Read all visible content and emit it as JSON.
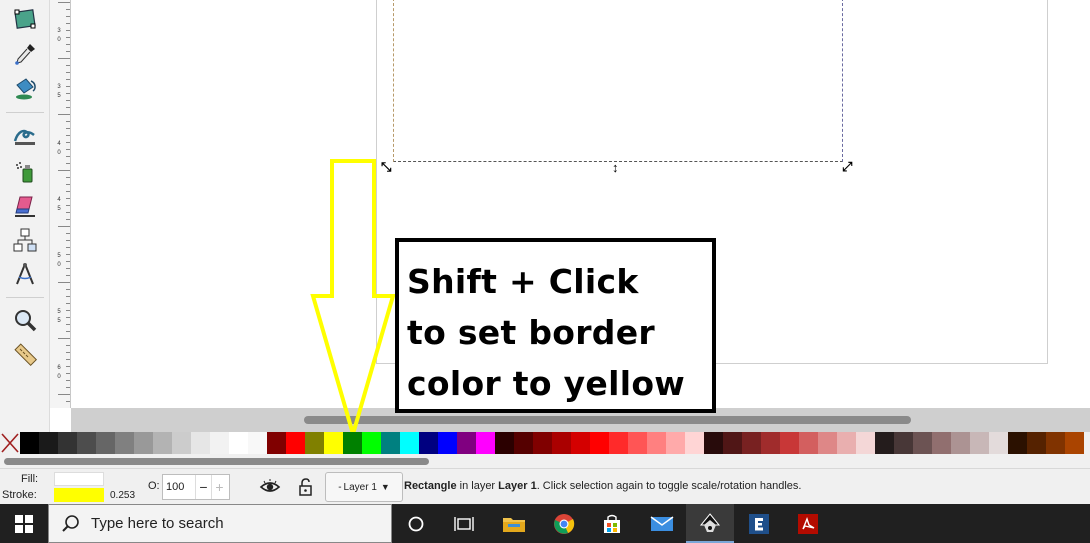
{
  "toolbox": {
    "tools": [
      "gradient-tool-icon",
      "dropper-tool-icon",
      "paint-bucket-icon",
      "tweak-tool-icon",
      "spray-tool-icon",
      "eraser-tool-icon",
      "connector-tool-icon",
      "measure-compass-icon",
      "zoom-tool-icon",
      "ruler-tool-icon"
    ]
  },
  "ruler": {
    "labels": [
      "3",
      "0",
      "3",
      "5",
      "4",
      "0",
      "4",
      "5",
      "5",
      "0",
      "5",
      "5",
      "6",
      "0"
    ]
  },
  "annotation": {
    "line1": "Shift + Click",
    "line2": "to set border",
    "line3": "color to yellow",
    "arrow_color": "#ffff00"
  },
  "palette": {
    "colors": [
      "#000000",
      "#1a1a1a",
      "#333333",
      "#4d4d4d",
      "#666666",
      "#808080",
      "#999999",
      "#b3b3b3",
      "#cccccc",
      "#e6e6e6",
      "#f2f2f2",
      "#ffffff",
      "#f8f8f8",
      "#800000",
      "#ff0000",
      "#808000",
      "#ffff00",
      "#008000",
      "#00ff00",
      "#008080",
      "#00ffff",
      "#000080",
      "#0000ff",
      "#800080",
      "#ff00ff",
      "#2b0000",
      "#550000",
      "#800000",
      "#aa0000",
      "#d40000",
      "#ff0000",
      "#ff2a2a",
      "#ff5555",
      "#ff8080",
      "#ffaaaa",
      "#ffd5d5",
      "#280b0b",
      "#501616",
      "#782121",
      "#a02c2c",
      "#c83737",
      "#d35f5f",
      "#de8787",
      "#e9afaf",
      "#f4d7d7",
      "#241c1c",
      "#483737",
      "#6c5353",
      "#916f6f",
      "#ac9393",
      "#c8b7b7",
      "#e3dbdb",
      "#2b1100",
      "#552200",
      "#803300",
      "#aa4400"
    ]
  },
  "status": {
    "fill_label": "Fill:",
    "stroke_label": "Stroke:",
    "stroke_width": "0.253",
    "opacity_label": "O:",
    "opacity_value": "100",
    "minus": "−",
    "plus": "+",
    "layer": "Layer 1",
    "object_type": "Rectangle",
    "in_layer_text": " in layer ",
    "layer_name": "Layer 1",
    "hint": ". Click selection again to toggle scale/rotation handles.",
    "fill_color": "#ffffff",
    "stroke_color": "#ffff00"
  },
  "taskbar": {
    "search_placeholder": "Type here to search",
    "apps": [
      "task-view-icon",
      "file-explorer-icon",
      "chrome-icon",
      "store-icon",
      "mail-icon",
      "inkscape-icon",
      "e-app-icon",
      "acrobat-icon"
    ]
  }
}
